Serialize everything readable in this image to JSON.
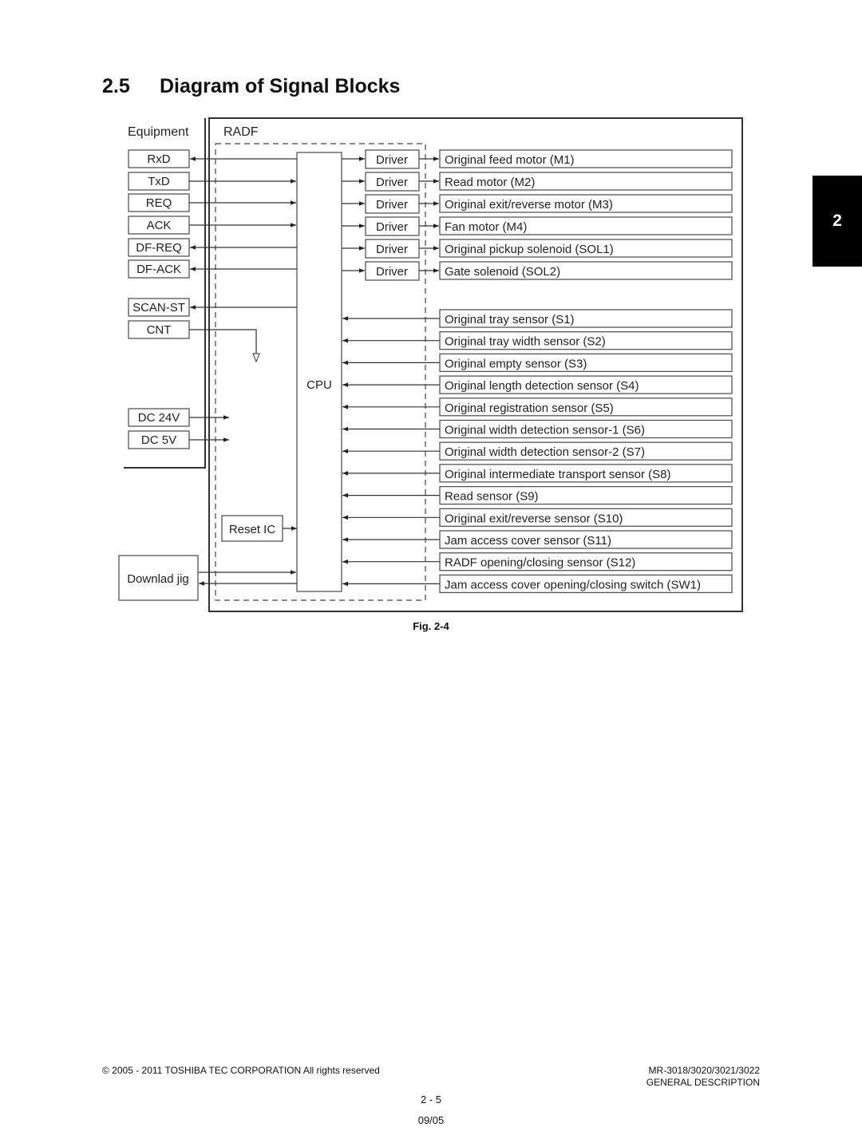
{
  "section": {
    "number": "2.5",
    "title": "Diagram of Signal Blocks"
  },
  "chapter_tab": "2",
  "diagram": {
    "equipment_label": "Equipment",
    "radf_label": "RADF",
    "cpu_label": "CPU",
    "reset_ic_label": "Reset IC",
    "download_jig_label": "Downlad jig",
    "equipment_signals": [
      {
        "label": "RxD",
        "direction": "to-equipment"
      },
      {
        "label": "TxD",
        "direction": "to-cpu"
      },
      {
        "label": "REQ",
        "direction": "to-cpu"
      },
      {
        "label": "ACK",
        "direction": "to-cpu"
      },
      {
        "label": "DF-REQ",
        "direction": "to-equipment"
      },
      {
        "label": "DF-ACK",
        "direction": "to-equipment"
      },
      {
        "label": "SCAN-ST",
        "direction": "to-equipment"
      },
      {
        "label": "CNT",
        "direction": "down"
      }
    ],
    "power_inputs": [
      {
        "label": "DC 24V"
      },
      {
        "label": "DC 5V"
      }
    ],
    "driver_label": "Driver",
    "outputs": [
      "Original feed motor (M1)",
      "Read motor (M2)",
      "Original exit/reverse motor (M3)",
      "Fan motor (M4)",
      "Original pickup solenoid (SOL1)",
      "Gate solenoid (SOL2)"
    ],
    "inputs": [
      "Original tray sensor (S1)",
      "Original tray width sensor (S2)",
      "Original empty sensor (S3)",
      "Original length detection sensor (S4)",
      "Original registration sensor (S5)",
      "Original width detection sensor-1 (S6)",
      "Original width detection sensor-2 (S7)",
      "Original intermediate transport sensor (S8)",
      "Read sensor (S9)",
      "Original exit/reverse sensor (S10)",
      "Jam access cover sensor (S11)",
      "RADF opening/closing sensor (S12)",
      "Jam access cover opening/closing switch (SW1)"
    ]
  },
  "figure_caption": "Fig. 2-4",
  "footer": {
    "copyright": "© 2005 - 2011 TOSHIBA TEC CORPORATION All rights reserved",
    "model": "MR-3018/3020/3021/3022",
    "manual_section": "GENERAL DESCRIPTION",
    "page": "2 - 5",
    "date": "09/05"
  }
}
